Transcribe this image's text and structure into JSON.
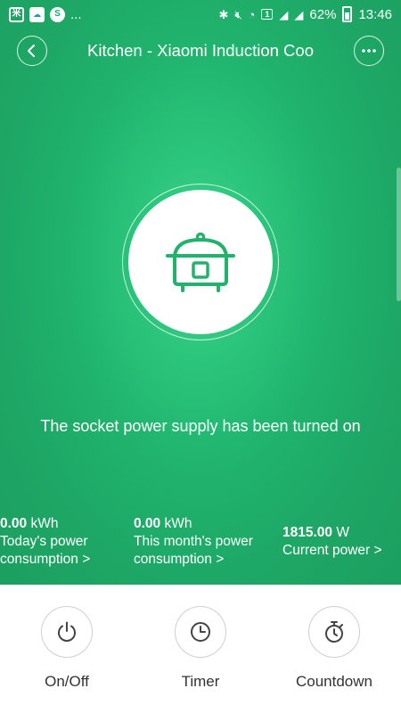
{
  "status_bar": {
    "left_icons": [
      "mi-home-icon",
      "cloud-app-icon",
      "skype-icon"
    ],
    "overflow": "...",
    "sim_label": "1",
    "battery": "62%",
    "time": "13:46"
  },
  "header": {
    "title": "Kitchen - Xiaomi Induction Coo",
    "back_icon": "chevron-left-icon",
    "more_icon": "more-dots-icon"
  },
  "device": {
    "icon": "cooker-icon",
    "status_message": "The socket power supply has been turned on"
  },
  "stats": [
    {
      "value": "0.00",
      "unit": "kWh",
      "label_line1": "Today's power",
      "label_line2": "consumption >"
    },
    {
      "value": "0.00",
      "unit": "kWh",
      "label_line1": "This month's power",
      "label_line2": "consumption >"
    },
    {
      "value": "1815.00",
      "unit": "W",
      "label_line1": "Current power >"
    }
  ],
  "toolbar": [
    {
      "label": "On/Off",
      "icon": "power-icon"
    },
    {
      "label": "Timer",
      "icon": "clock-icon"
    },
    {
      "label": "Countdown",
      "icon": "stopwatch-icon"
    }
  ],
  "colors": {
    "primary_green": "#1ea766",
    "accent_green": "#23b26c",
    "toolbar_bg": "#ffffff"
  }
}
